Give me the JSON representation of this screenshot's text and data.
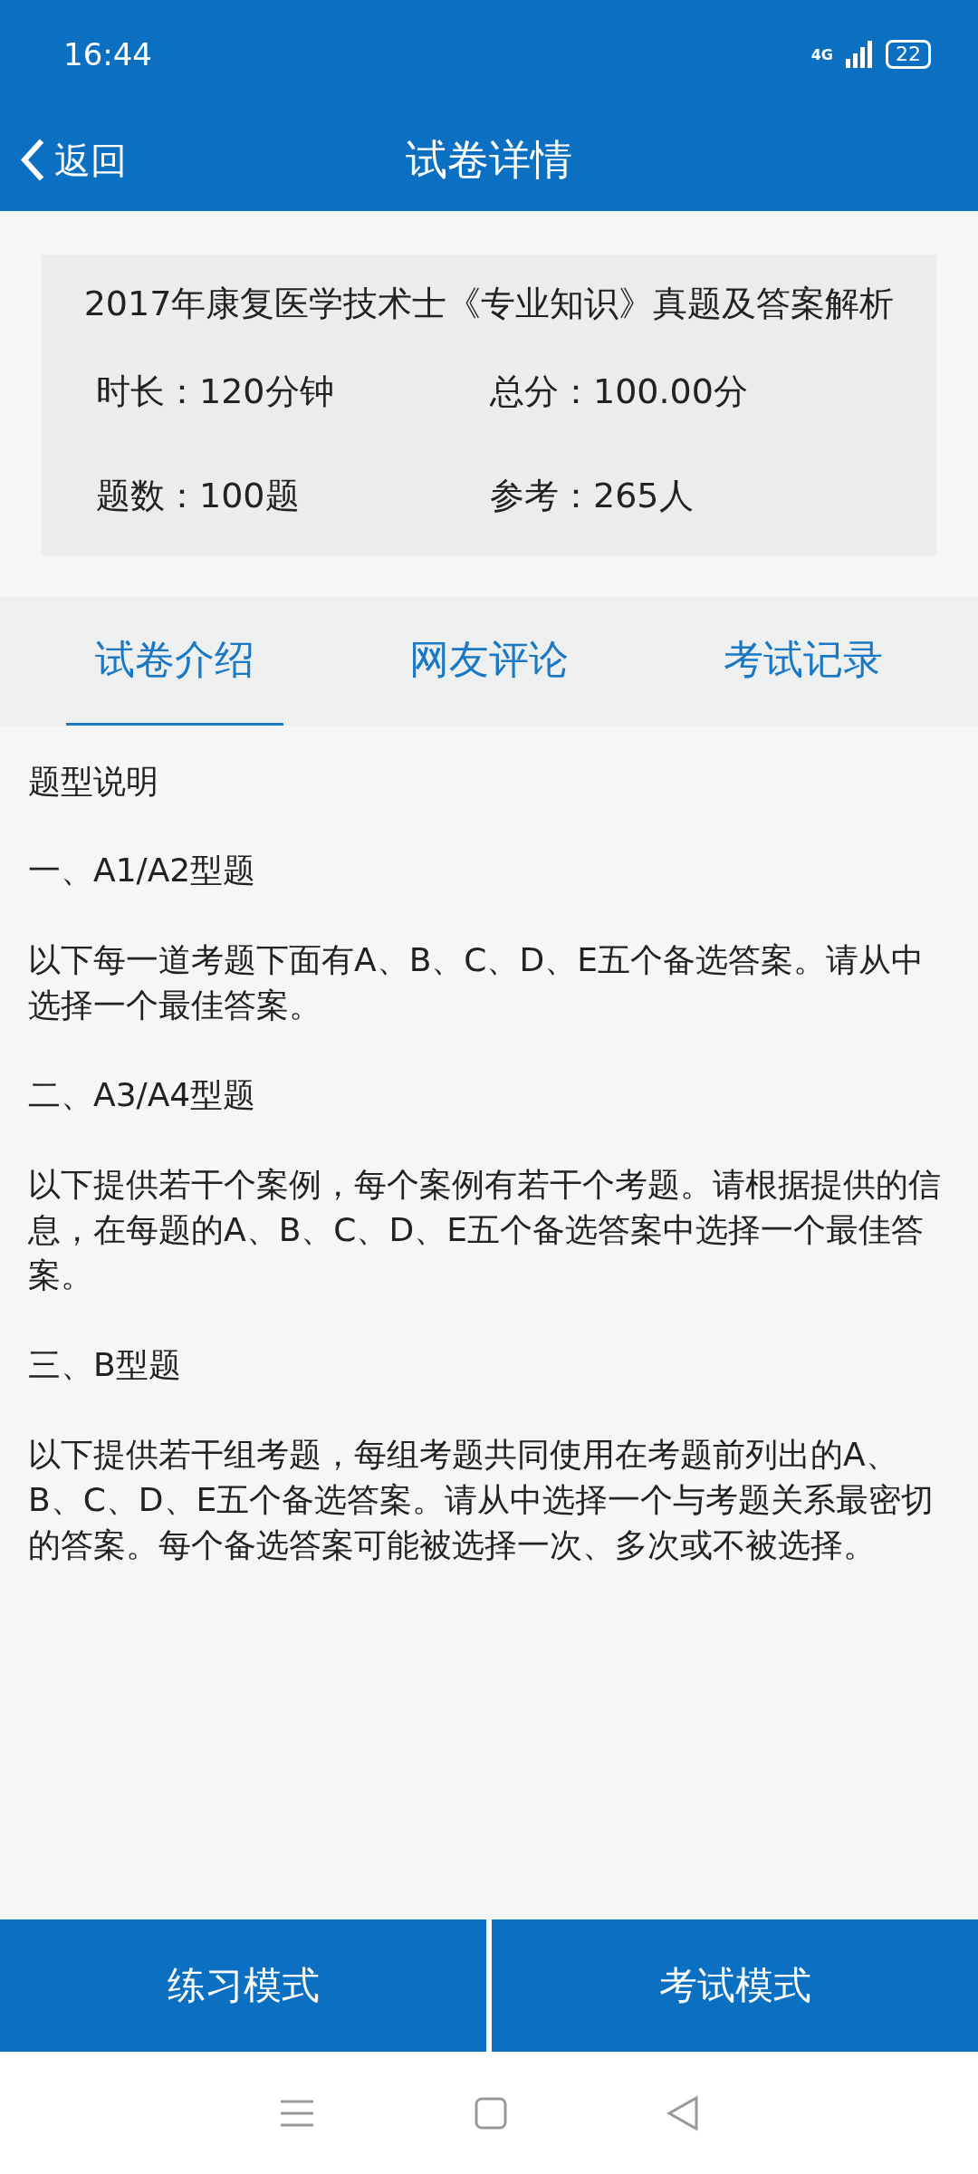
{
  "status_bar": {
    "time": "16:44",
    "network": "4G",
    "battery": "22"
  },
  "header": {
    "back": "返回",
    "title": "试卷详情"
  },
  "exam": {
    "title": "2017年康复医学技术士《专业知识》真题及答案解析",
    "stats": [
      {
        "label": "时长：120分钟"
      },
      {
        "label": "总分：100.00分"
      },
      {
        "label": "题数：100题"
      },
      {
        "label": "参考：265人"
      }
    ]
  },
  "tabs": [
    {
      "label": "试卷介绍",
      "selected": true
    },
    {
      "label": "网友评论",
      "selected": false
    },
    {
      "label": "考试记录",
      "selected": false
    }
  ],
  "content": [
    {
      "kind": "heading",
      "text": "题型说明"
    },
    {
      "kind": "heading",
      "text": "一、A1/A2型题"
    },
    {
      "kind": "paragraph",
      "text": "以下每一道考题下面有A、B、C、D、E五个备选答案。请从中选择一个最佳答案。"
    },
    {
      "kind": "heading",
      "text": "二、A3/A4型题"
    },
    {
      "kind": "paragraph",
      "text": "以下提供若干个案例，每个案例有若干个考题。请根据提供的信息，在每题的A、B、C、D、E五个备选答案中选择一个最佳答案。"
    },
    {
      "kind": "heading",
      "text": "三、B型题"
    },
    {
      "kind": "paragraph",
      "text": "以下提供若干组考题，每组考题共同使用在考题前列出的A、B、C、D、E五个备选答案。请从中选择一个与考题关系最密切的答案。每个备选答案可能被选择一次、多次或不被选择。"
    }
  ],
  "buttons": [
    "练习模式",
    "考试模式"
  ]
}
